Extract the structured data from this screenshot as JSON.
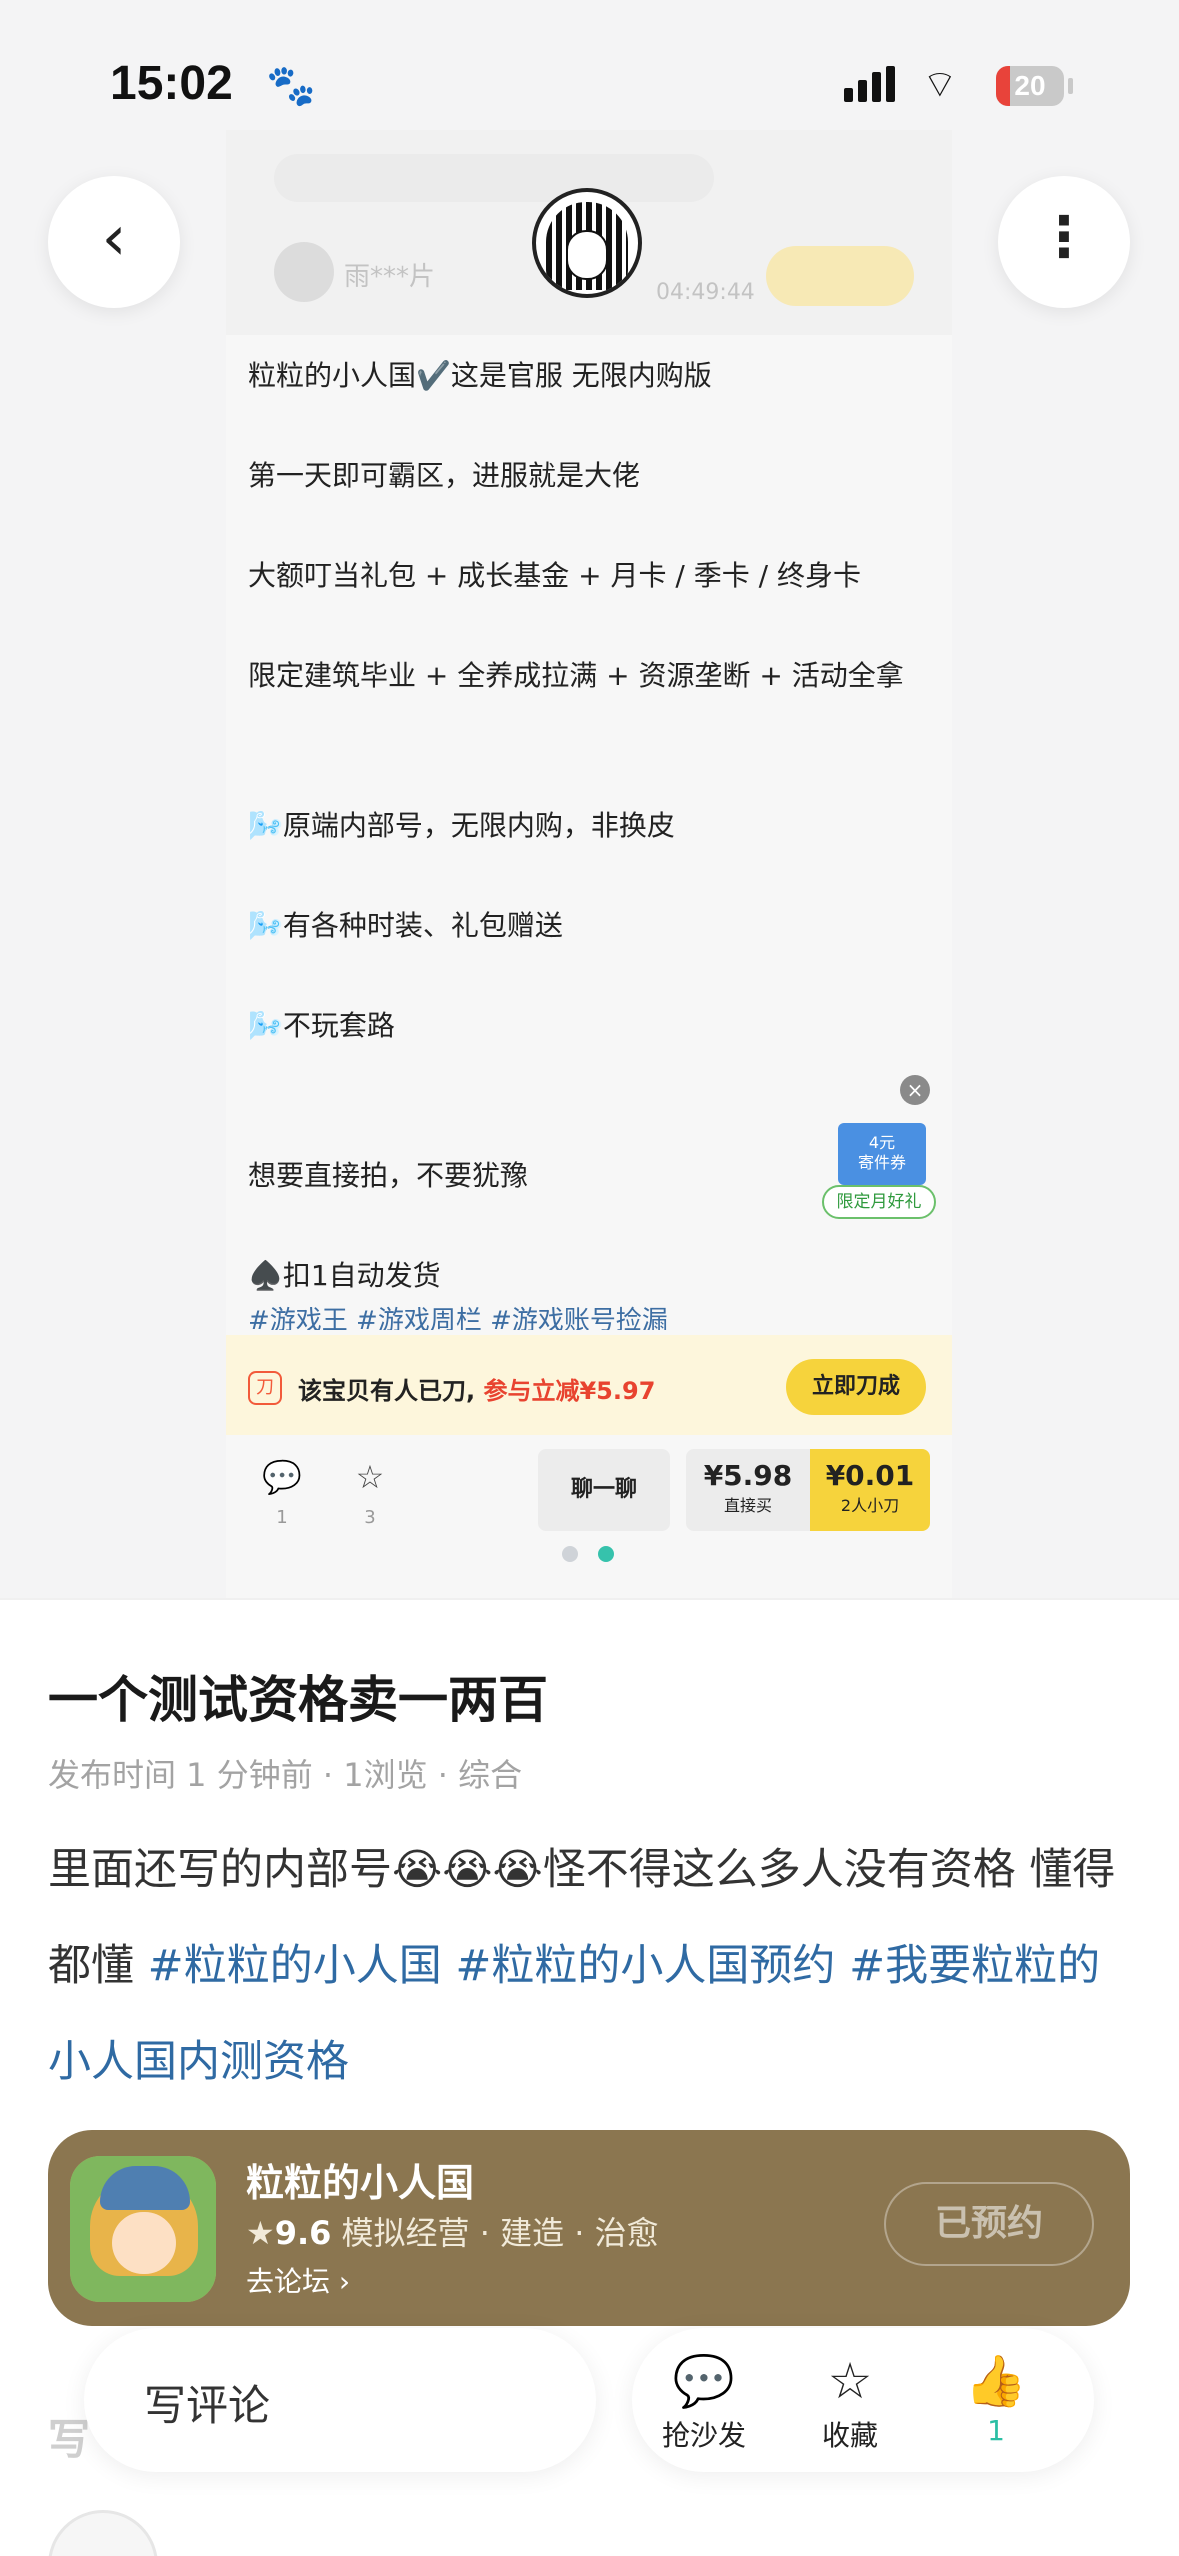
{
  "status_bar": {
    "time": "15:02",
    "battery": "20",
    "battery_level": 0.2
  },
  "nav": {
    "back": "‹",
    "more": "⋮"
  },
  "listing": {
    "search_placeholder": "",
    "seller_name": "雨***片",
    "timer": "04:49:44",
    "description_lines": [
      "粒粒的小人国✔️这是官服 无限内购版",
      "第一天即可霸区，进服就是大佬",
      "大额叮当礼包 + 成长基金 + 月卡 / 季卡 / 终身卡",
      "限定建筑毕业 + 全养成拉满 + 资源垄断 + 活动全拿",
      "🌬️原端内部号，无限内购，非换皮",
      "🌬️有各种时装、礼包赠送",
      "🌬️不玩套路",
      "想要直接拍，不要犹豫",
      "♠️扣1自动发货"
    ],
    "tags": "#游戏王 #游戏周栏 #游戏账号捡漏",
    "coupon": {
      "amount": "4元",
      "name": "寄件券",
      "footer": "限定月好礼",
      "close": "×"
    },
    "cut_notice": {
      "icon": "刀",
      "text": "该宝贝有人已刀,",
      "highlight": "参与立减¥5.97",
      "button": "立即刀成"
    },
    "actions": {
      "comment_count": "1",
      "star_count": "3",
      "chat": "聊一聊",
      "buy_price": "¥5.98",
      "buy_label": "直接买",
      "cut_price": "¥0.01",
      "cut_label": "2人小刀"
    },
    "page_indicator": {
      "total": 2,
      "active": 2
    }
  },
  "post": {
    "title": "一个测试资格卖一两百",
    "meta": "发布时间 1 分钟前 · 1浏览 · 综合",
    "body": "里面还写的内部号😭😭😭怪不得这么多人没有资格 懂得都懂",
    "tags": [
      "#粒粒的小人国",
      "#粒粒的小人国预约",
      "#我要粒粒的小人国内测资格"
    ]
  },
  "game_card": {
    "name": "粒粒的小人国",
    "rating": "9.6",
    "genres": "模拟经营 · 建造 · 治愈",
    "forum_link": "去论坛",
    "button": "已预约"
  },
  "bottom_bar": {
    "comment_placeholder": "写评论",
    "sofa": "抢沙发",
    "favorite": "收藏",
    "like_count": "1"
  },
  "peek": {
    "section": "写"
  },
  "colors": {
    "accent": "#2bbfa4",
    "link": "#2f6aa3",
    "card": "#8b7650",
    "cut_yellow": "#f6d33c"
  }
}
